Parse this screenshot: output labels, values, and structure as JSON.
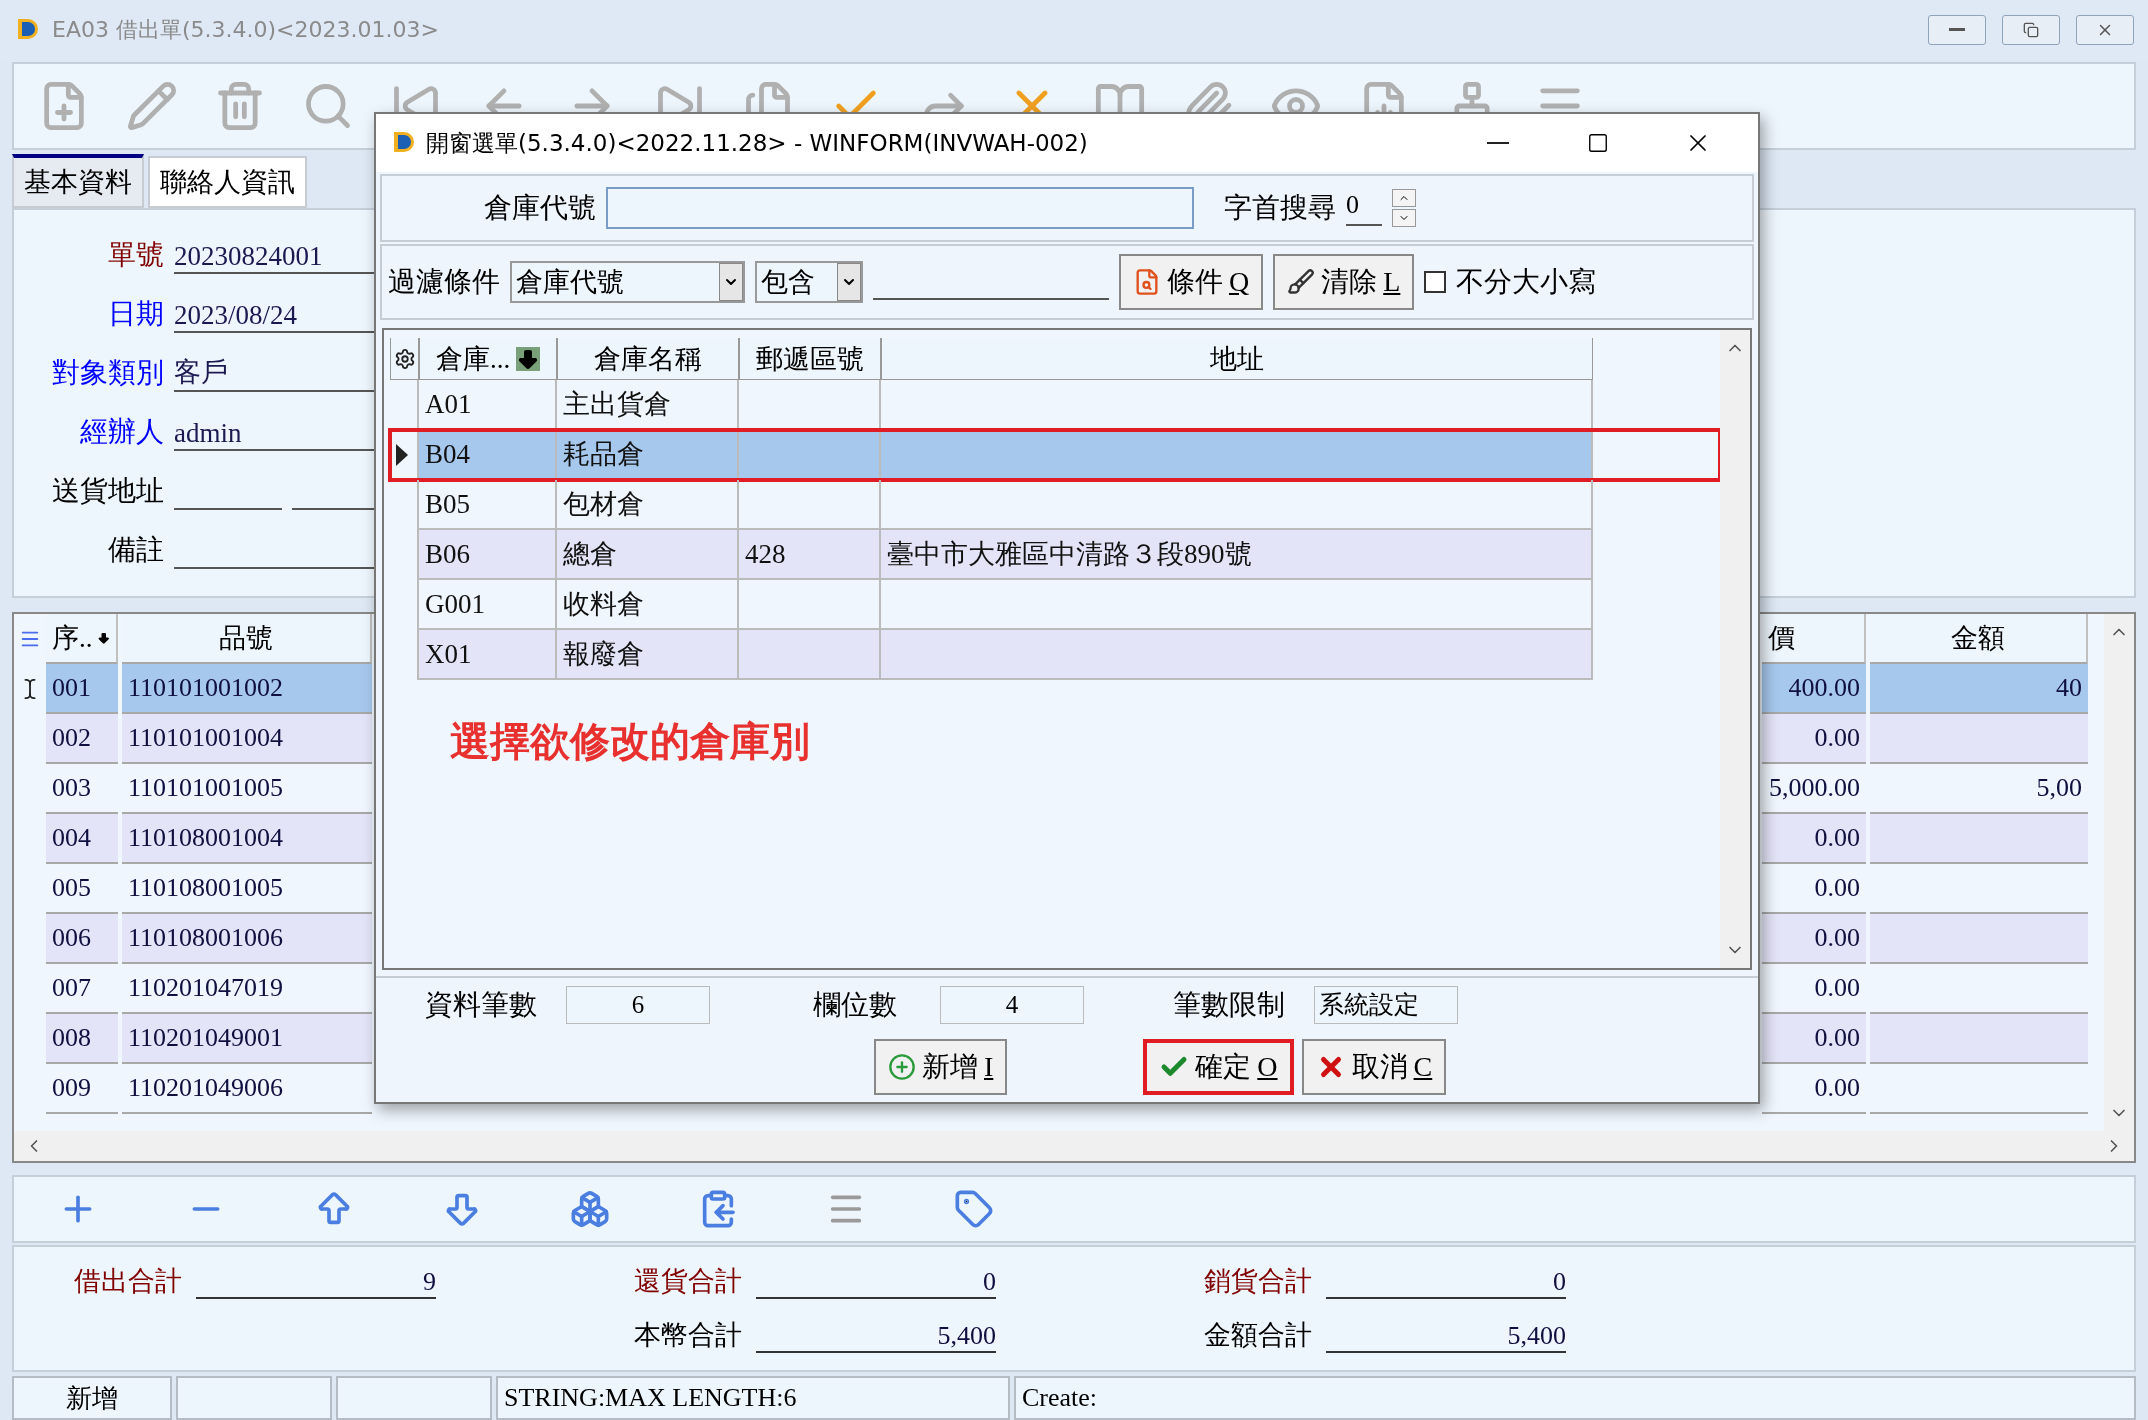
{
  "window": {
    "title": "EA03 借出單(5.3.4.0)<2023.01.03>"
  },
  "tabs": [
    {
      "label": "基本資料",
      "selected": true
    },
    {
      "label": "聯絡人資訊",
      "selected": false
    }
  ],
  "form": {
    "fields": [
      {
        "label": "單號",
        "color": "#800000",
        "value": "20230824001",
        "kind": "single"
      },
      {
        "label": "日期",
        "color": "#0000ff",
        "value": "2023/08/24",
        "kind": "single"
      },
      {
        "label": "對象類別",
        "color": "#0000ff",
        "value": "客戶",
        "kind": "single"
      },
      {
        "label": "經辦人",
        "color": "#0000ff",
        "value": "admin",
        "kind": "single"
      },
      {
        "label": "送貨地址",
        "color": "#000000",
        "kind": "double"
      },
      {
        "label": "備註",
        "color": "#000000",
        "kind": "single"
      }
    ]
  },
  "grid": {
    "columns": [
      "序..",
      "品號",
      "價",
      "金額"
    ],
    "rows": [
      {
        "seq": "001",
        "item": "110101001002",
        "price": "400.00",
        "amount": "40",
        "selected": true
      },
      {
        "seq": "002",
        "item": "110101001004",
        "price": "0.00",
        "selected": false
      },
      {
        "seq": "003",
        "item": "110101001005",
        "price": "5,000.00",
        "amount": "5,00",
        "selected": false
      },
      {
        "seq": "004",
        "item": "110108001004",
        "price": "0.00",
        "selected": false
      },
      {
        "seq": "005",
        "item": "110108001005",
        "price": "0.00",
        "selected": false
      },
      {
        "seq": "006",
        "item": "110108001006",
        "price": "0.00",
        "selected": false
      },
      {
        "seq": "007",
        "item": "110201047019",
        "price": "0.00",
        "selected": false
      },
      {
        "seq": "008",
        "item": "110201049001",
        "price": "0.00",
        "selected": false
      },
      {
        "seq": "009",
        "item": "110201049006",
        "price": "0.00",
        "selected": false
      }
    ]
  },
  "totals": {
    "row_1": [
      {
        "label": "借出合計",
        "value": "9",
        "color": "#800000"
      },
      {
        "label": "還貨合計",
        "value": "0",
        "color": "#800000"
      },
      {
        "label": "銷貨合計",
        "value": "0",
        "color": "#800000"
      }
    ],
    "row_2": [
      {
        "label": "本幣合計",
        "value": "5,400",
        "color": "#000000"
      },
      {
        "label": "金額合計",
        "value": "5,400",
        "color": "#000000"
      }
    ]
  },
  "status_bar": {
    "mode": "新增",
    "message": "STRING:MAX LENGTH:6",
    "info": "Create:"
  },
  "dialog": {
    "title": "開窗選單(5.3.4.0)<2022.11.28> - WINFORM(INVWAH-002)",
    "code_label": "倉庫代號",
    "prefix_search": {
      "label": "字首搜尋",
      "value": "0"
    },
    "filter": {
      "label": "過濾條件",
      "field": "倉庫代號",
      "operator": "包含"
    },
    "filter_buttons": [
      {
        "kind": "query",
        "label": "條件",
        "hotkey": "Q"
      },
      {
        "kind": "clear",
        "label": "清除",
        "hotkey": "L"
      }
    ],
    "case_insensitive": {
      "label": "不分大小寫",
      "checked": false
    },
    "columns": [
      "倉庫...",
      "倉庫名稱",
      "郵遞區號",
      "地址"
    ],
    "rows": [
      {
        "code": "A01",
        "name": "主出貨倉",
        "selected": false,
        "outlined": false
      },
      {
        "code": "B04",
        "name": "耗品倉",
        "selected": true,
        "outlined": true
      },
      {
        "code": "B05",
        "name": "包材倉",
        "selected": false,
        "outlined": false
      },
      {
        "code": "B06",
        "name": "總倉",
        "zip": "428",
        "address": "臺中市大雅區中清路３段890號",
        "selected": false,
        "outlined": false
      },
      {
        "code": "G001",
        "name": "收料倉",
        "selected": false,
        "outlined": false
      },
      {
        "code": "X01",
        "name": "報廢倉",
        "selected": false,
        "outlined": false
      }
    ],
    "note": "選擇欲修改的倉庫別",
    "stats": [
      {
        "label": "資料筆數",
        "value": "6"
      },
      {
        "label": "欄位數",
        "value": "4"
      },
      {
        "label": "筆數限制",
        "value": "系統設定"
      }
    ],
    "buttons": [
      {
        "kind": "add",
        "label": "新增",
        "hotkey": "I",
        "outlined": false
      },
      {
        "kind": "ok",
        "label": "確定",
        "hotkey": "O",
        "outlined": true
      },
      {
        "kind": "cancel",
        "label": "取消",
        "hotkey": "C",
        "outlined": false
      }
    ]
  }
}
